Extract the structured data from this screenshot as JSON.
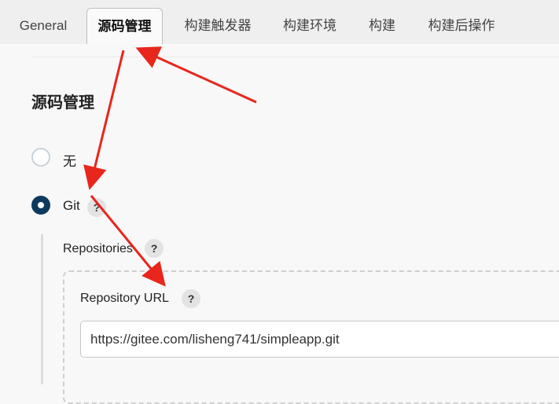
{
  "tabs": [
    {
      "label": "General",
      "active": false
    },
    {
      "label": "源码管理",
      "active": true
    },
    {
      "label": "构建触发器",
      "active": false
    },
    {
      "label": "构建环境",
      "active": false
    },
    {
      "label": "构建",
      "active": false
    },
    {
      "label": "构建后操作",
      "active": false
    }
  ],
  "scm": {
    "title": "源码管理",
    "options": [
      {
        "label": "无",
        "selected": false
      },
      {
        "label": "Git",
        "selected": true
      }
    ],
    "help_glyph": "?",
    "repositories_label": "Repositories",
    "repository_url_label": "Repository URL",
    "repository_url_value": "https://gitee.com/lisheng741/simpleapp.git"
  },
  "annotation_color": "#e8261c",
  "accent_color": "#0d3b5e"
}
